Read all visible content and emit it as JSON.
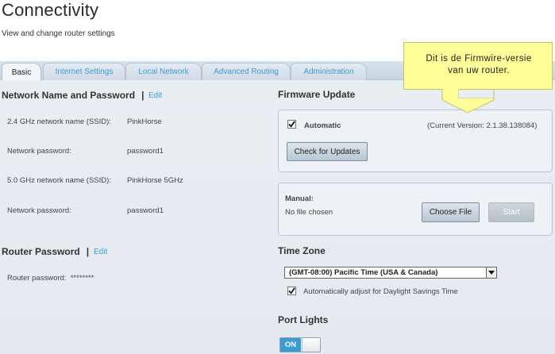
{
  "page": {
    "title": "Connectivity",
    "subtitle": "View and change router settings"
  },
  "tabs": [
    {
      "label": "Basic",
      "active": true
    },
    {
      "label": "Internet Settings",
      "active": false
    },
    {
      "label": "Local Network",
      "active": false
    },
    {
      "label": "Advanced Routing",
      "active": false
    },
    {
      "label": "Administration",
      "active": false
    }
  ],
  "network": {
    "title": "Network Name and Password",
    "separator": "|",
    "edit_label": "Edit",
    "fields": [
      {
        "label": "2.4 GHz network name (SSID):",
        "value": "PinkHorse"
      },
      {
        "label": "Network password:",
        "value": "password1"
      },
      {
        "label": "5.0 GHz network name (SSID):",
        "value": "PinkHorse 5GHz"
      },
      {
        "label": "Network password:",
        "value": "password1"
      }
    ]
  },
  "router_password": {
    "title": "Router Password",
    "separator": "|",
    "edit_label": "Edit",
    "label": "Router password:",
    "value": "********"
  },
  "firmware": {
    "title": "Firmware Update",
    "automatic_label": "Automatic",
    "automatic_checked": true,
    "current_version": "(Current Version: 2.1.38.138084)",
    "check_button": "Check for Updates",
    "manual_label": "Manual:",
    "file_status": "No file chosen",
    "choose_file_button": "Choose File",
    "start_button": "Start"
  },
  "time_zone": {
    "title": "Time Zone",
    "selected": "(GMT-08:00) Pacific Time (USA & Canada)",
    "dst_label": "Automatically adjust for Daylight Savings Time",
    "dst_checked": true
  },
  "port_lights": {
    "title": "Port Lights",
    "state": "ON"
  },
  "tooltip": {
    "line1": "Dit is de Firmwire-versie",
    "line2": "van uw router."
  },
  "colors": {
    "link": "#3d9ad6",
    "toggle_on": "#3d9ad6",
    "tooltip_bg": "#ffff99"
  }
}
